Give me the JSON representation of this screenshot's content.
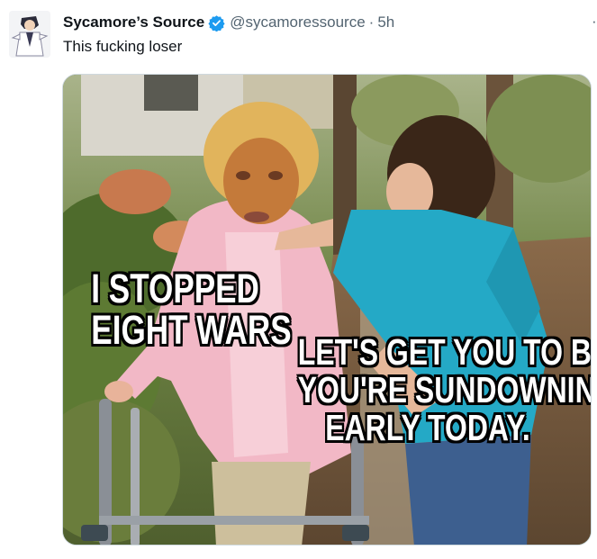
{
  "tweet": {
    "display_name": "Sycamore’s Source",
    "handle": "@sycamoressource",
    "separator": "·",
    "timestamp": "5h",
    "text": "This fucking loser",
    "more_label": "·"
  },
  "media": {
    "caption_left": [
      "I STOPPED",
      "EIGHT WARS"
    ],
    "caption_right": [
      "LET'S GET YOU TO BED.",
      "YOU'RE SUNDOWNING",
      "EARLY TODAY."
    ]
  },
  "colors": {
    "verified": "#1d9bf0",
    "secondary_text": "#536471",
    "border": "#cfd9de"
  }
}
